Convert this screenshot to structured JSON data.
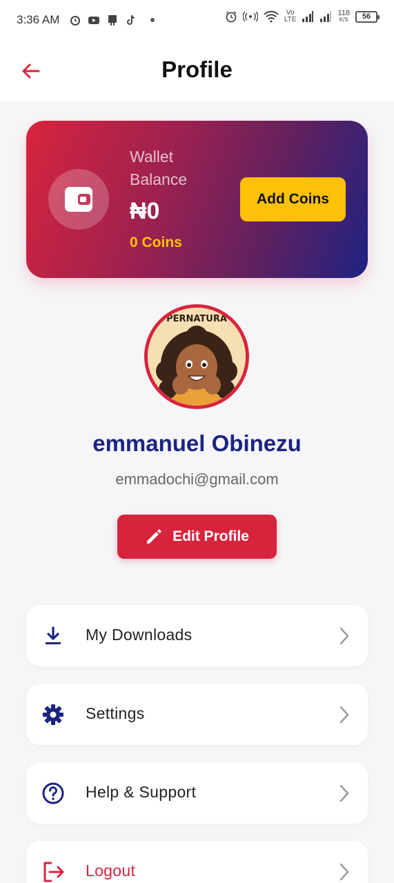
{
  "status_bar": {
    "time": "3:36 AM",
    "network_speed": "118",
    "network_speed_unit": "K/S",
    "lte_top": "Vo",
    "lte_bottom": "LTE",
    "battery": "56"
  },
  "header": {
    "title": "Profile"
  },
  "wallet": {
    "label": "Wallet Balance",
    "amount": "₦0",
    "coins": "0 Coins",
    "add_coins_label": "Add Coins"
  },
  "profile": {
    "avatar_text": "PERNATURA",
    "name": "emmanuel Obinezu",
    "email": "emmadochi@gmail.com",
    "edit_label": "Edit Profile"
  },
  "menu": {
    "downloads": "My Downloads",
    "settings": "Settings",
    "help": "Help & Support",
    "logout": "Logout"
  },
  "colors": {
    "accent_red": "#d7243d",
    "navy": "#1c2481",
    "gold": "#ffc107",
    "background": "#f6f6f9"
  },
  "icons": {
    "back": "arrow-left-icon",
    "wallet": "wallet-icon",
    "edit": "pencil-icon",
    "downloads": "download-icon",
    "settings": "gear-icon",
    "help": "help-circle-icon",
    "logout": "logout-icon",
    "chevron": "chevron-right-icon"
  }
}
